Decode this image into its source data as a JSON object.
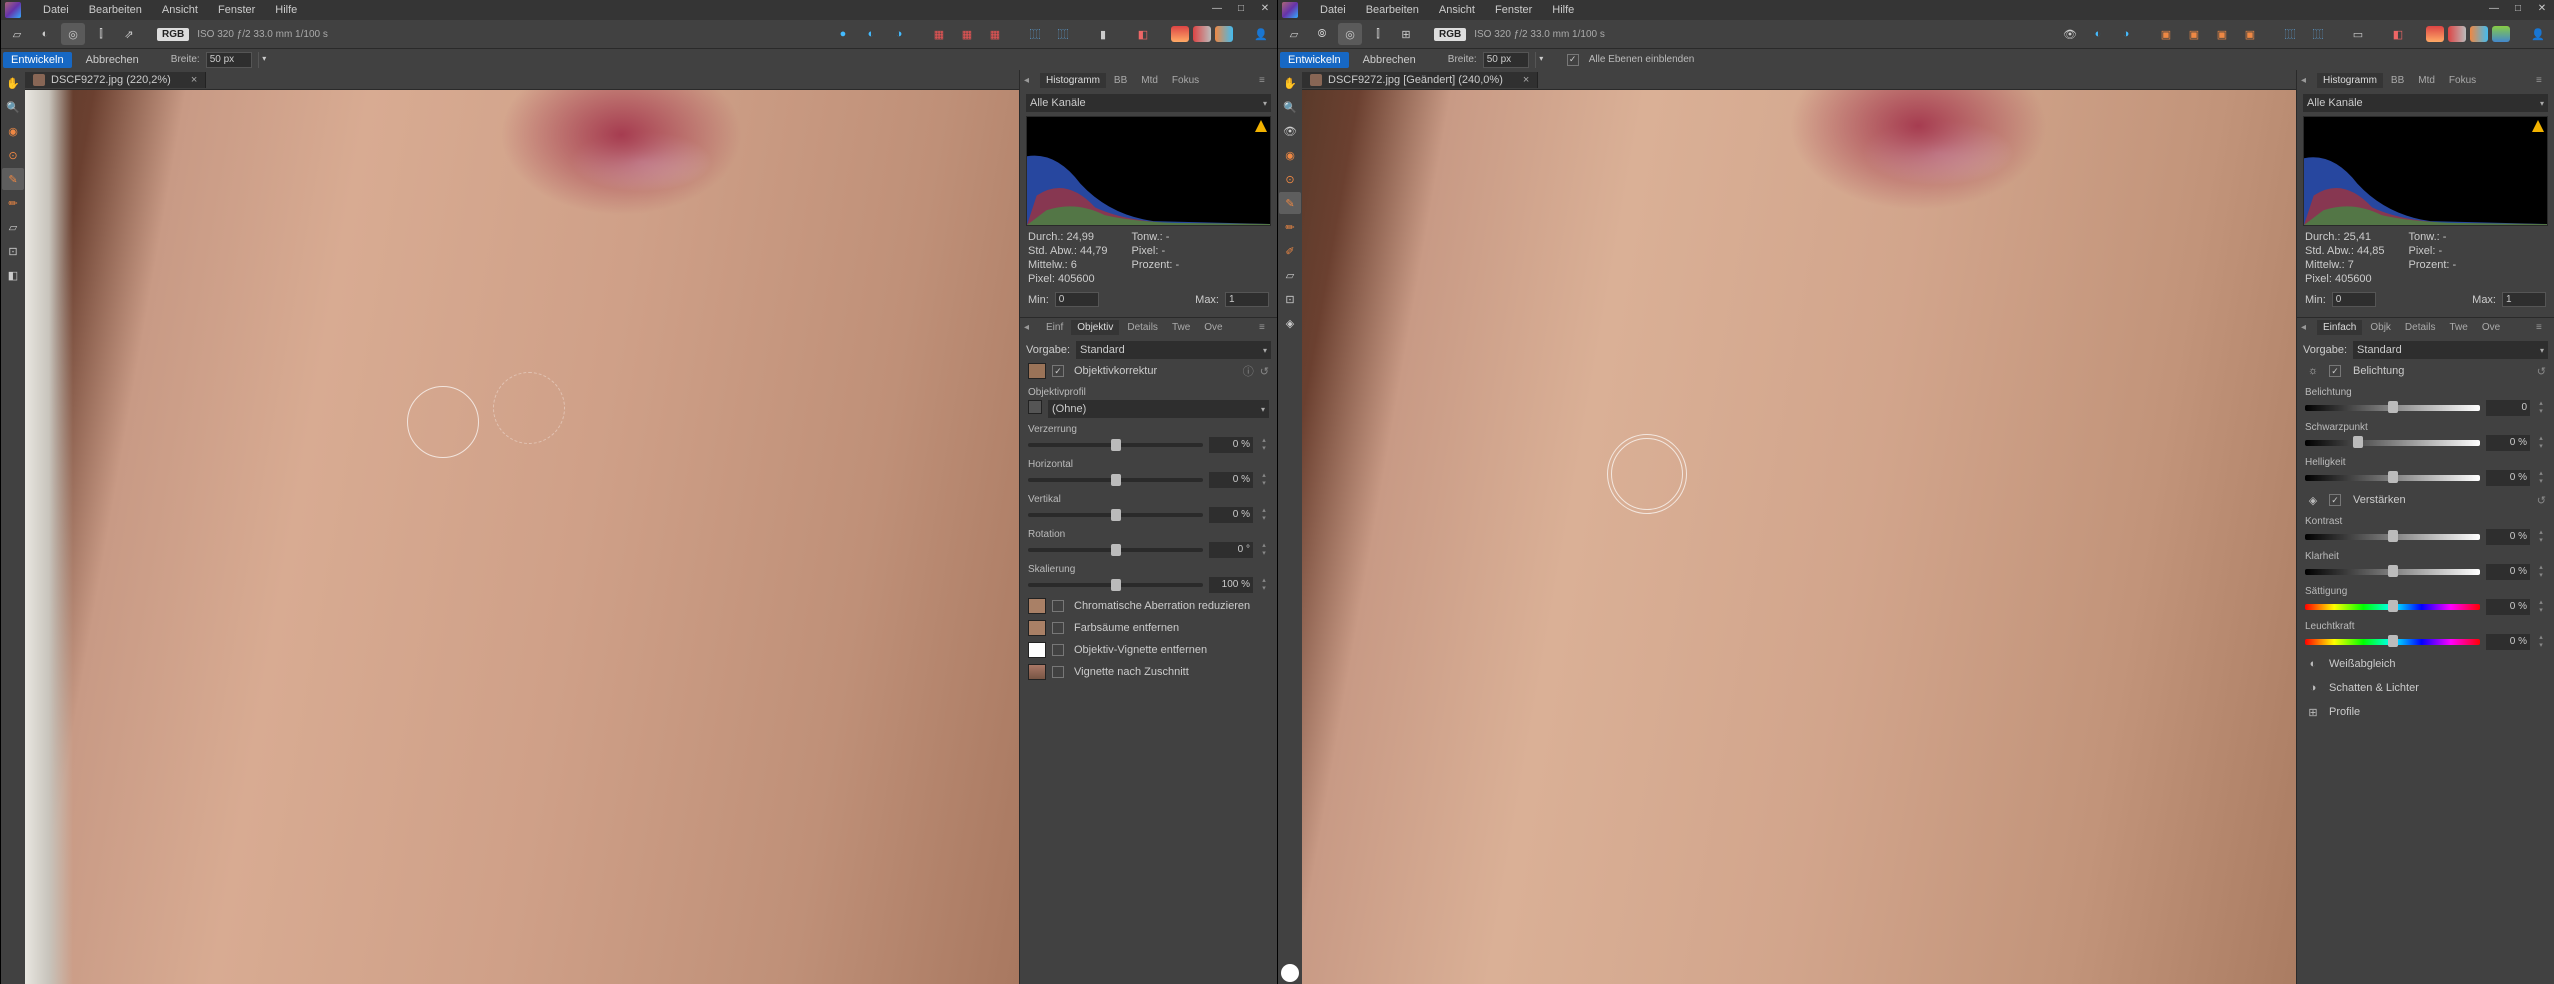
{
  "menu": {
    "file": "Datei",
    "edit": "Bearbeiten",
    "view": "Ansicht",
    "window": "Fenster",
    "help": "Hilfe"
  },
  "toolbar_info": {
    "rgb": "RGB",
    "meta": "ISO 320 ƒ/2 33.0 mm 1/100 s"
  },
  "context": {
    "develop": "Entwickeln",
    "cancel": "Abbrechen",
    "width": "Breite:",
    "width_val": "50 px",
    "show_all_layers": "Alle Ebenen einblenden"
  },
  "left": {
    "doc_title": "DSCF9272.jpg (220,2%)",
    "panel_tabs": {
      "histogram": "Histogramm",
      "bb": "BB",
      "mtd": "Mtd",
      "fokus": "Fokus"
    },
    "channels": "Alle Kanäle",
    "stats": {
      "durch": "Durch.: 24,99",
      "stdabw": "Std. Abw.: 44,79",
      "mittelw": "Mittelw.: 6",
      "pixel": "Pixel: 405600",
      "tonw": "Tonw.: -",
      "pixel2": "Pixel: -",
      "prozent": "Prozent: -"
    },
    "min": "Min:",
    "min_v": "0",
    "max": "Max:",
    "max_v": "1",
    "dev_tabs": {
      "einf": "Einf",
      "objektiv": "Objektiv",
      "details": "Details",
      "twe": "Twe",
      "ove": "Ove"
    },
    "preset": "Vorgabe:",
    "preset_v": "Standard",
    "lenscorr": "Objektivkorrektur",
    "lensprofile": "Objektivprofil",
    "lensprofile_v": "(Ohne)",
    "sliders": {
      "verz": "Verzerrung",
      "horiz": "Horizontal",
      "vert": "Vertikal",
      "rot": "Rotation",
      "skal": "Skalierung"
    },
    "vals": {
      "pct0": "0 %",
      "deg0": "0 °",
      "pct100": "100 %"
    },
    "checks": {
      "chroma": "Chromatische Aberration reduzieren",
      "fringe": "Farbsäume entfernen",
      "vignette": "Objektiv-Vignette entfernen",
      "postcrop": "Vignette nach Zuschnitt"
    }
  },
  "right": {
    "doc_title": "DSCF9272.jpg [Geändert] (240,0%)",
    "panel_tabs": {
      "histogram": "Histogramm",
      "bb": "BB",
      "mtd": "Mtd",
      "fokus": "Fokus"
    },
    "channels": "Alle Kanäle",
    "stats": {
      "durch": "Durch.: 25,41",
      "stdabw": "Std. Abw.: 44,85",
      "mittelw": "Mittelw.: 7",
      "pixel": "Pixel: 405600",
      "tonw": "Tonw.: -",
      "pixel2": "Pixel: -",
      "prozent": "Prozent: -"
    },
    "min": "Min:",
    "min_v": "0",
    "max": "Max:",
    "max_v": "1",
    "dev_tabs": {
      "einfach": "Einfach",
      "objk": "Objk",
      "details": "Details",
      "twe": "Twe",
      "ove": "Ove"
    },
    "preset": "Vorgabe:",
    "preset_v": "Standard",
    "belichtung_hdr": "Belichtung",
    "verstaerken_hdr": "Verstärken",
    "sliders": {
      "belichtung": "Belichtung",
      "schwarzpunkt": "Schwarzpunkt",
      "helligkeit": "Helligkeit",
      "kontrast": "Kontrast",
      "klarheit": "Klarheit",
      "saettigung": "Sättigung",
      "leuchtkraft": "Leuchtkraft"
    },
    "vals": {
      "zero": "0",
      "pct0": "0 %"
    },
    "acc": {
      "wb": "Weißabgleich",
      "shadows": "Schatten & Lichter",
      "profile": "Profile"
    }
  }
}
